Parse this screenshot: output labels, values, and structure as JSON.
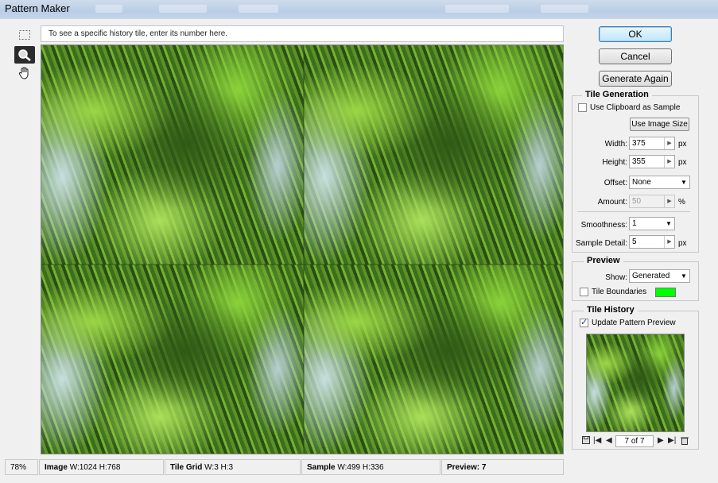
{
  "window": {
    "title": "Pattern Maker"
  },
  "hint": {
    "text": "To see a specific history tile, enter its number here."
  },
  "tools": [
    {
      "name": "marquee-tool-icon"
    },
    {
      "name": "zoom-tool-icon"
    },
    {
      "name": "hand-tool-icon"
    }
  ],
  "buttons": {
    "ok": "OK",
    "cancel": "Cancel",
    "generate_again": "Generate Again"
  },
  "tile_generation": {
    "title": "Tile Generation",
    "use_clipboard_label": "Use Clipboard as Sample",
    "use_clipboard_checked": false,
    "use_image_size_label": "Use Image Size",
    "width_label": "Width:",
    "width_value": "375",
    "width_unit": "px",
    "height_label": "Height:",
    "height_value": "355",
    "height_unit": "px",
    "offset_label": "Offset:",
    "offset_value": "None",
    "amount_label": "Amount:",
    "amount_value": "50",
    "amount_unit": "%",
    "smoothness_label": "Smoothness:",
    "smoothness_value": "1",
    "sample_detail_label": "Sample Detail:",
    "sample_detail_value": "5",
    "sample_detail_unit": "px"
  },
  "preview_group": {
    "title": "Preview",
    "show_label": "Show:",
    "show_value": "Generated",
    "tile_boundaries_label": "Tile Boundaries",
    "tile_boundaries_checked": false,
    "boundary_color": "#00ff00"
  },
  "tile_history": {
    "title": "Tile History",
    "update_preview_label": "Update Pattern Preview",
    "update_preview_checked": true,
    "page": "7 of 7"
  },
  "status": {
    "zoom": "78%",
    "image_label": "Image",
    "image_value": "W:1024 H:768",
    "grid_label": "Tile Grid",
    "grid_value": "W:3 H:3",
    "sample_label": "Sample",
    "sample_value": "W:499 H:336",
    "preview_label": "Preview:",
    "preview_value": "7"
  }
}
